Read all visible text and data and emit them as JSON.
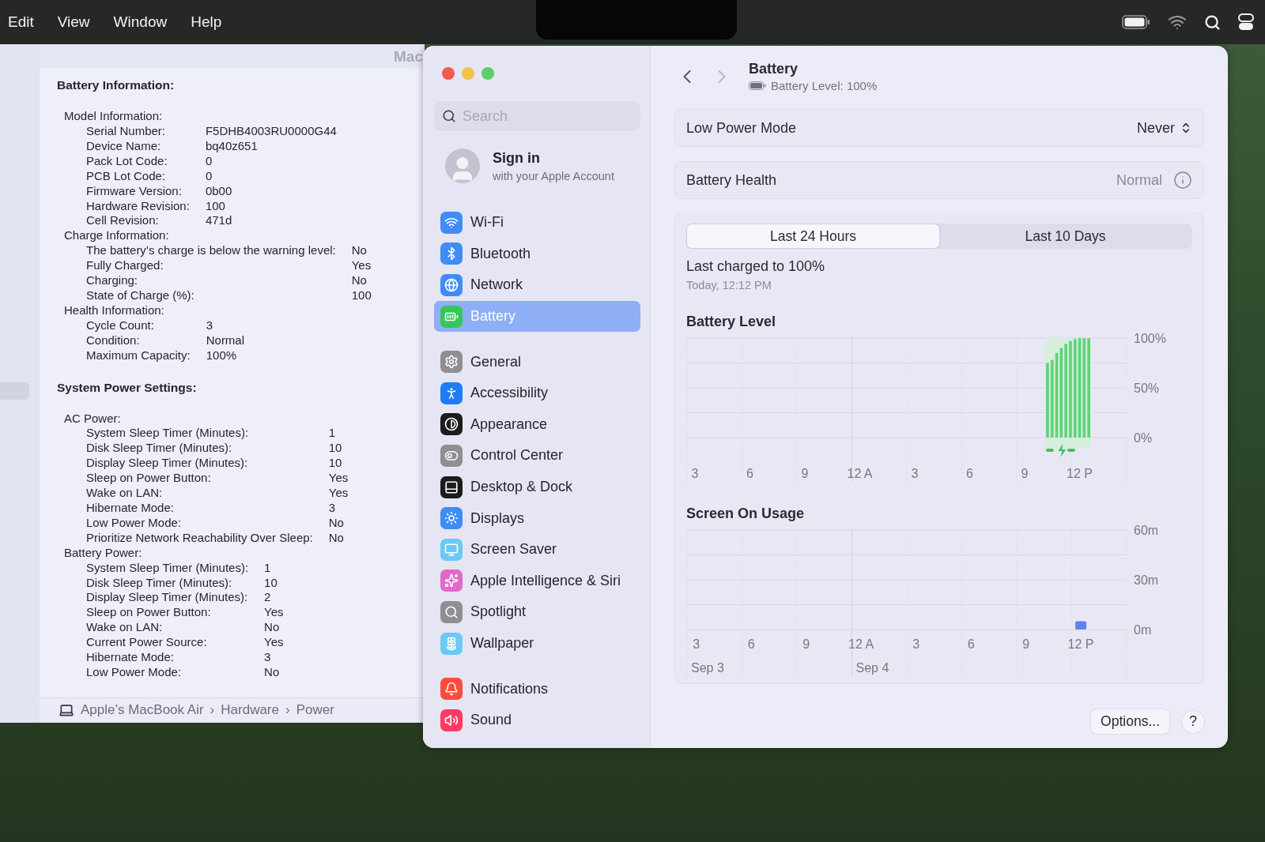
{
  "menu_bar": {
    "items": [
      "Edit",
      "View",
      "Window",
      "Help"
    ]
  },
  "info_window": {
    "title": "Mac",
    "sections": [
      {
        "title": "Battery Information:",
        "groups": [
          {
            "title": "Model Information:",
            "rows": [
              {
                "label": "Serial Number:",
                "value": "F5DHB4003RU0000G44"
              },
              {
                "label": "Device Name:",
                "value": "bq40z651"
              },
              {
                "label": "Pack Lot Code:",
                "value": "0"
              },
              {
                "label": "PCB Lot Code:",
                "value": "0"
              },
              {
                "label": "Firmware Version:",
                "value": "0b00"
              },
              {
                "label": "Hardware Revision:",
                "value": "100"
              },
              {
                "label": "Cell Revision:",
                "value": "471d"
              }
            ]
          },
          {
            "title": "Charge Information:",
            "rows": [
              {
                "label": "The battery’s charge is below the warning level:",
                "value": "No"
              },
              {
                "label": "Fully Charged:",
                "value": "Yes"
              },
              {
                "label": "Charging:",
                "value": "No"
              },
              {
                "label": "State of Charge (%):",
                "value": "100"
              }
            ]
          },
          {
            "title": "Health Information:",
            "rows": [
              {
                "label": "Cycle Count:",
                "value": "3"
              },
              {
                "label": "Condition:",
                "value": "Normal"
              },
              {
                "label": "Maximum Capacity:",
                "value": "100%"
              }
            ]
          }
        ]
      },
      {
        "title": "System Power Settings:",
        "groups": [
          {
            "title": "AC Power:",
            "rows": [
              {
                "label": "System Sleep Timer (Minutes):",
                "value": "1"
              },
              {
                "label": "Disk Sleep Timer (Minutes):",
                "value": "10"
              },
              {
                "label": "Display Sleep Timer (Minutes):",
                "value": "10"
              },
              {
                "label": "Sleep on Power Button:",
                "value": "Yes"
              },
              {
                "label": "Wake on LAN:",
                "value": "Yes"
              },
              {
                "label": "Hibernate Mode:",
                "value": "3"
              },
              {
                "label": "Low Power Mode:",
                "value": "No"
              },
              {
                "label": "Prioritize Network Reachability Over Sleep:",
                "value": "No"
              }
            ]
          },
          {
            "title": "Battery Power:",
            "rows": [
              {
                "label": "System Sleep Timer (Minutes):",
                "value": "1"
              },
              {
                "label": "Disk Sleep Timer (Minutes):",
                "value": "10"
              },
              {
                "label": "Display Sleep Timer (Minutes):",
                "value": "2"
              },
              {
                "label": "Sleep on Power Button:",
                "value": "Yes"
              },
              {
                "label": "Wake on LAN:",
                "value": "No"
              },
              {
                "label": "Current Power Source:",
                "value": "Yes"
              },
              {
                "label": "Hibernate Mode:",
                "value": "3"
              },
              {
                "label": "Low Power Mode:",
                "value": "No"
              }
            ]
          }
        ]
      }
    ],
    "breadcrumb": {
      "separator": "›",
      "items": [
        "Apple’s MacBook Air",
        "Hardware",
        "Power"
      ]
    }
  },
  "settings_window": {
    "sidebar": {
      "search": {
        "placeholder": "Search"
      },
      "account": {
        "title": "Sign in",
        "subtitle": "with your Apple Account"
      },
      "groups": [
        [
          {
            "label": "Wi-Fi",
            "selected": false,
            "color": "#3f8cf5"
          },
          {
            "label": "Bluetooth",
            "selected": false,
            "color": "#3f8cf5"
          },
          {
            "label": "Network",
            "selected": false,
            "color": "#3f8cf5"
          },
          {
            "label": "Battery",
            "selected": true,
            "color": "#34c759"
          }
        ],
        [
          {
            "label": "General",
            "selected": false,
            "color": "#8e8e93"
          },
          {
            "label": "Accessibility",
            "selected": false,
            "color": "#1f7cf2"
          },
          {
            "label": "Appearance",
            "selected": false,
            "color": "#1c1c1e"
          },
          {
            "label": "Control Center",
            "selected": false,
            "color": "#8e8e93"
          },
          {
            "label": "Desktop & Dock",
            "selected": false,
            "color": "#1c1c1e"
          },
          {
            "label": "Displays",
            "selected": false,
            "color": "#3f8cf5"
          },
          {
            "label": "Screen Saver",
            "selected": false,
            "color": "#6cc8f5"
          },
          {
            "label": "Apple Intelligence & Siri",
            "selected": false,
            "color": "#e06ac8"
          },
          {
            "label": "Spotlight",
            "selected": false,
            "color": "#8e8e93"
          },
          {
            "label": "Wallpaper",
            "selected": false,
            "color": "#6cc8f5"
          }
        ],
        [
          {
            "label": "Notifications",
            "selected": false,
            "color": "#ff4b3e"
          },
          {
            "label": "Sound",
            "selected": false,
            "color": "#ff3b62"
          }
        ]
      ]
    },
    "header": {
      "title": "Battery",
      "subtitle": "Battery Level: 100%",
      "forward_disabled": true
    },
    "low_power_mode": {
      "label": "Low Power Mode",
      "value": "Never"
    },
    "battery_health": {
      "label": "Battery Health",
      "value": "Normal"
    },
    "tabs": [
      {
        "label": "Last 24 Hours",
        "selected": true
      },
      {
        "label": "Last 10 Days",
        "selected": false
      }
    ],
    "last_charged": {
      "title": "Last charged to 100%",
      "time": "Today, 12:12 PM"
    },
    "charts": [
      {
        "kind": "battery",
        "chart_data": {
          "type": "bar",
          "title": "Battery Level",
          "categories": [
            "3",
            null,
            null,
            null,
            null,
            null,
            null,
            null,
            null,
            null,
            null,
            null,
            "6",
            null,
            null,
            null,
            null,
            null,
            null,
            null,
            null,
            null,
            null,
            null,
            "9",
            null,
            null,
            null,
            null,
            null,
            null,
            null,
            null,
            null,
            null,
            null,
            "12 A",
            null,
            null,
            null,
            null,
            null,
            null,
            null,
            null,
            null,
            null,
            null,
            "3",
            null,
            null,
            null,
            null,
            null,
            null,
            null,
            null,
            null,
            null,
            null,
            "6",
            null,
            null,
            null,
            null,
            null,
            null,
            null,
            null,
            null,
            null,
            null,
            "9",
            null,
            null,
            null,
            null,
            null,
            null,
            null,
            null,
            null,
            null,
            null,
            "12 P",
            null,
            null,
            null,
            null,
            null,
            null,
            null,
            null,
            null,
            null,
            null
          ],
          "values": [
            null,
            null,
            null,
            null,
            null,
            null,
            null,
            null,
            null,
            null,
            null,
            null,
            null,
            null,
            null,
            null,
            null,
            null,
            null,
            null,
            null,
            null,
            null,
            null,
            null,
            null,
            null,
            null,
            null,
            null,
            null,
            null,
            null,
            null,
            null,
            null,
            null,
            null,
            null,
            null,
            null,
            null,
            null,
            null,
            null,
            null,
            null,
            null,
            null,
            null,
            null,
            null,
            null,
            null,
            null,
            null,
            null,
            null,
            null,
            null,
            null,
            null,
            null,
            null,
            null,
            null,
            null,
            null,
            null,
            null,
            null,
            null,
            null,
            null,
            null,
            null,
            null,
            75,
            78,
            85,
            90,
            94,
            97,
            99,
            100,
            100,
            100,
            null,
            null,
            null,
            null,
            null,
            null,
            null,
            null,
            null
          ],
          "ylim": [
            0,
            100
          ],
          "yticks": [
            {
              "value": 0,
              "label": "0%"
            },
            {
              "value": 50,
              "label": "50%"
            },
            {
              "value": 100,
              "label": "100%"
            }
          ]
        }
      },
      {
        "kind": "usage",
        "chart_data": {
          "type": "bar",
          "title": "Screen On Usage",
          "categories": [
            "3",
            null,
            null,
            "6",
            null,
            null,
            "9",
            null,
            null,
            "12 A",
            null,
            null,
            "3",
            null,
            null,
            "6",
            null,
            null,
            "9",
            null,
            null,
            "12 P",
            null,
            null
          ],
          "values": [
            null,
            null,
            null,
            null,
            null,
            null,
            null,
            null,
            null,
            null,
            null,
            null,
            null,
            null,
            null,
            null,
            null,
            null,
            null,
            null,
            null,
            5,
            null,
            null
          ],
          "ylim": [
            0,
            60
          ],
          "yticks": [
            {
              "value": 0,
              "label": "0m"
            },
            {
              "value": 30,
              "label": "30m"
            },
            {
              "value": 60,
              "label": "60m"
            }
          ],
          "annotations": [
            "Sep 3",
            "Sep 4"
          ]
        }
      }
    ],
    "buttons": {
      "options": "Options...",
      "help": "?"
    }
  }
}
